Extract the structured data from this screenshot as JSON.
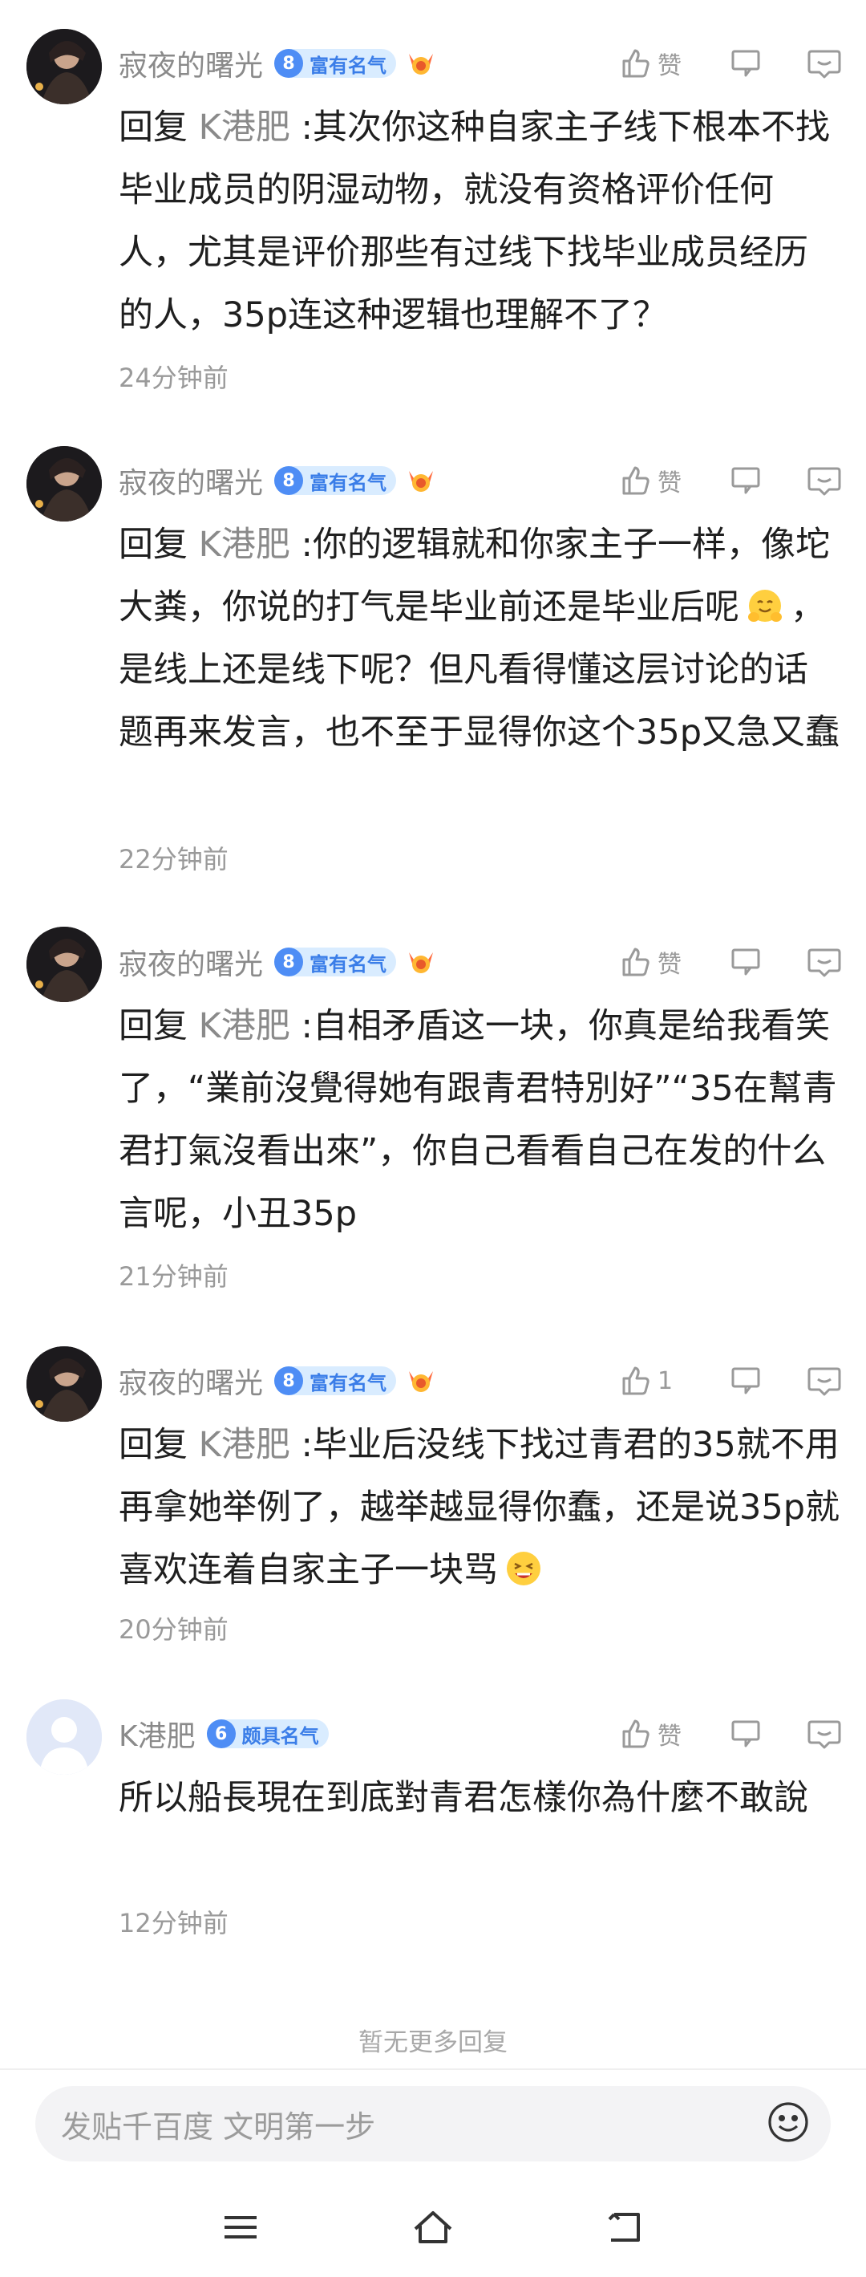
{
  "comments": [
    {
      "author": "寂夜的曙光",
      "level": "8",
      "badge": "富有名气",
      "like": "赞",
      "reply_prefix": "回复",
      "reply_target": "K港肥",
      "text_before": " :其次你这种自家主子线下根本不找毕业成员的阴湿动物，就没有资格评价任何人，尤其是评价那些有过线下找毕业成员经历的人，35p连这种逻辑也理解不了？",
      "text_after": "",
      "time": "24分钟前"
    },
    {
      "author": "寂夜的曙光",
      "level": "8",
      "badge": "富有名气",
      "like": "赞",
      "reply_prefix": "回复",
      "reply_target": "K港肥",
      "text_before": " :你的逻辑就和你家主子一样，像坨大粪，你说的打气是毕业前还是毕业后呢",
      "text_after": "，是线上还是线下呢？但凡看得懂这层讨论的话题再来发言，也不至于显得你这个35p又急又蠢",
      "time": "22分钟前"
    },
    {
      "author": "寂夜的曙光",
      "level": "8",
      "badge": "富有名气",
      "like": "赞",
      "reply_prefix": "回复",
      "reply_target": "K港肥",
      "text_before": " :自相矛盾这一块，你真是给我看笑了，“業前沒覺得她有跟青君特別好”“35在幫青君打氣沒看出來”，你自己看看自己在发的什么言呢，小丑35p",
      "text_after": "",
      "time": "21分钟前"
    },
    {
      "author": "寂夜的曙光",
      "level": "8",
      "badge": "富有名气",
      "like": "1",
      "reply_prefix": "回复",
      "reply_target": "K港肥",
      "text_before": " :毕业后没线下找过青君的35就不用再拿她举例了，越举越显得你蠢，还是说35p就喜欢连着自家主子一块骂",
      "text_after": "",
      "time": "20分钟前"
    },
    {
      "author": "K港肥",
      "level": "6",
      "badge": "颇具名气",
      "like": "赞",
      "reply_prefix": "",
      "reply_target": "",
      "text_before": "所以船長現在到底對青君怎樣你為什麼不敢說",
      "text_after": "",
      "time": "12分钟前"
    }
  ],
  "footer": {
    "no_more": "暂无更多回复",
    "input_placeholder": "发贴千百度 文明第一步"
  },
  "colors": {
    "badge_bg": "#d9ecff",
    "badge_level": "#4e8df5",
    "badge_text": "#3a7de8",
    "muted_text": "#8a8a8a",
    "icon": "#9a9a9a"
  },
  "icons": [
    "thumb-up-icon",
    "thumb-down-icon",
    "reply-bubble-icon",
    "medal-icon",
    "smile-emoji-icon",
    "menu-icon",
    "home-icon",
    "back-icon"
  ]
}
